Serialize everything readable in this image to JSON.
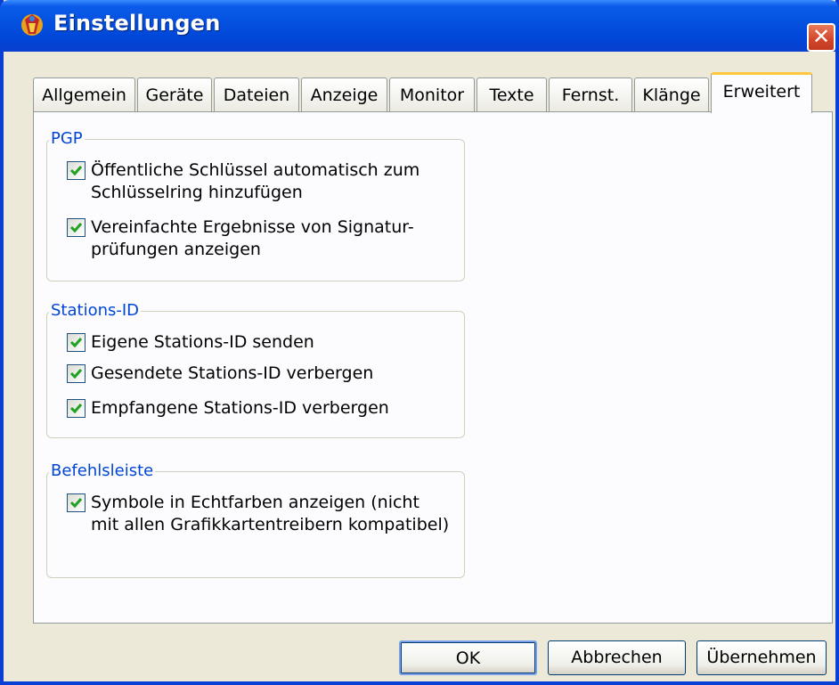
{
  "window": {
    "title": "Einstellungen",
    "close_glyph": "✕"
  },
  "tabs": [
    {
      "label": "Allgemein"
    },
    {
      "label": "Geräte"
    },
    {
      "label": "Dateien"
    },
    {
      "label": "Anzeige"
    },
    {
      "label": "Monitor"
    },
    {
      "label": "Texte"
    },
    {
      "label": "Fernst."
    },
    {
      "label": "Klänge"
    },
    {
      "label": "Erweitert",
      "active": true
    }
  ],
  "groups": {
    "pgp": {
      "label": "PGP",
      "items": [
        {
          "line1": "Öffentliche Schlüssel automatisch zum",
          "line2": "Schlüsselring hinzufügen",
          "checked": true
        },
        {
          "line1": "Vereinfachte Ergebnisse von Signatur-",
          "line2": "prüfungen anzeigen",
          "checked": true
        }
      ]
    },
    "stations": {
      "label": "Stations-ID",
      "items": [
        {
          "line1": "Eigene Stations-ID senden",
          "checked": true
        },
        {
          "line1": "Gesendete Stations-ID verbergen",
          "checked": true
        },
        {
          "line1": "Empfangene Stations-ID verbergen",
          "checked": true
        }
      ]
    },
    "toolbar": {
      "label": "Befehlsleiste",
      "items": [
        {
          "line1": "Symbole in Echtfarben anzeigen (nicht",
          "line2": "mit allen Grafikkartentreibern kompatibel)",
          "checked": true
        }
      ]
    }
  },
  "buttons": {
    "ok": "OK",
    "cancel": "Abbrechen",
    "apply": "Übernehmen"
  },
  "colors": {
    "titlebar": "#0552e0",
    "group_label": "#0046d5",
    "check": "#21a121",
    "active_tab_accent": "#ffc83c"
  }
}
